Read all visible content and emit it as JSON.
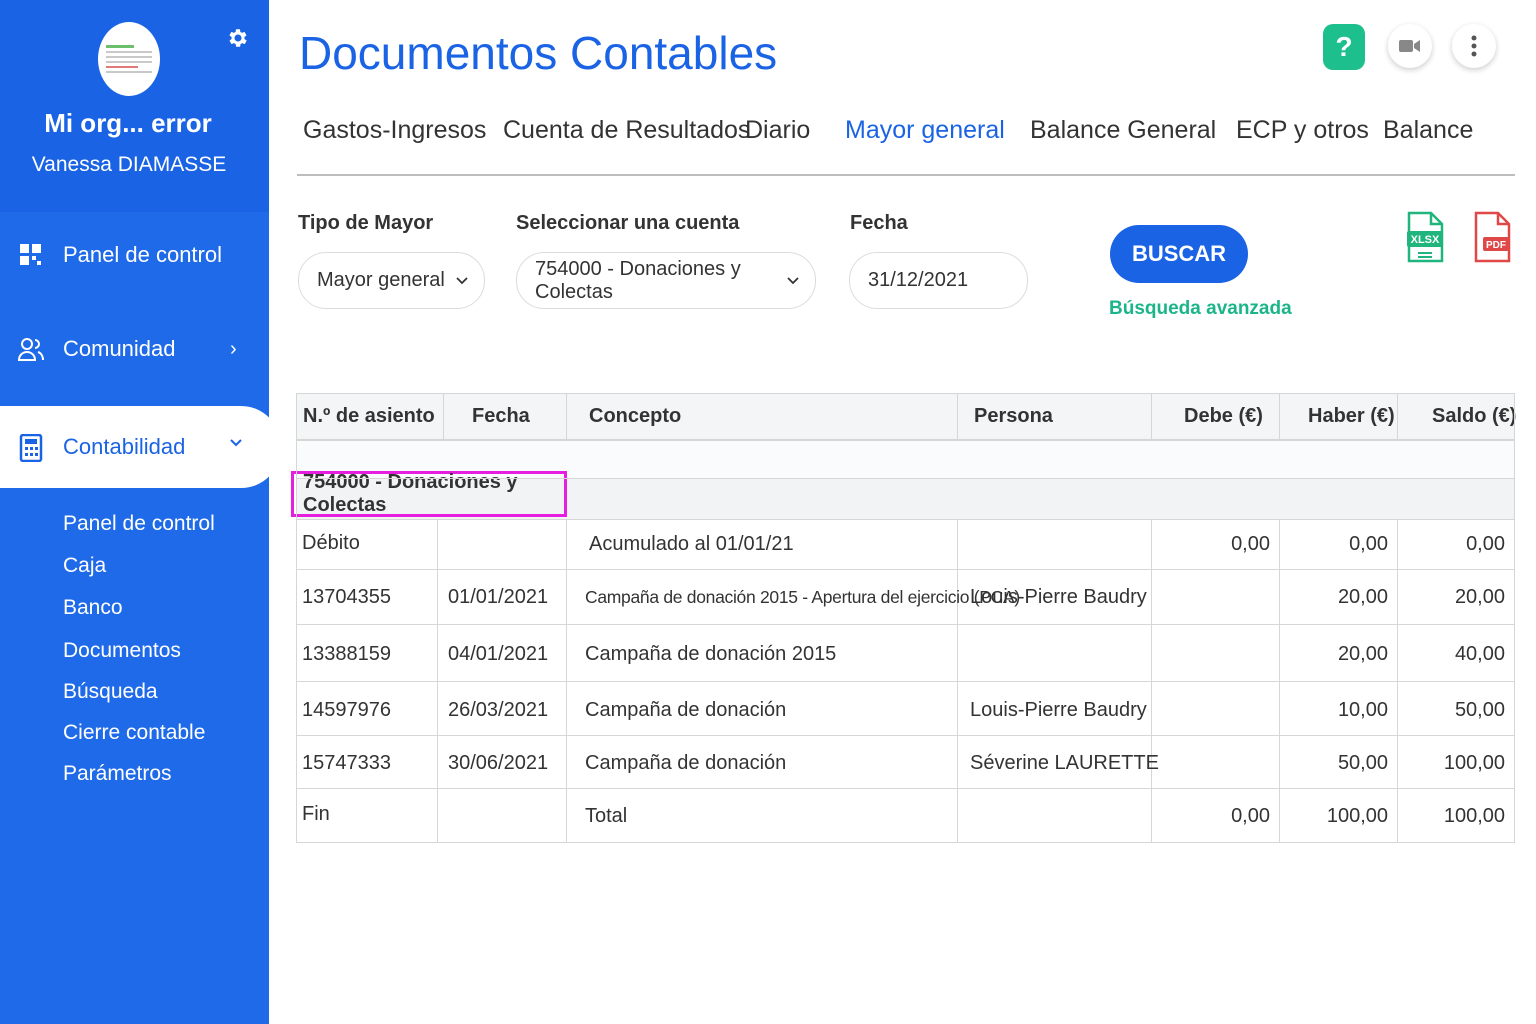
{
  "sidebar": {
    "org_name": "Mi org... error",
    "user_name": "Vanessa DIAMASSE",
    "nav": [
      {
        "label": "Panel de control",
        "icon": "dashboard-icon"
      },
      {
        "label": "Comunidad",
        "icon": "people-icon"
      },
      {
        "label": "Contabilidad",
        "icon": "calculator-icon"
      }
    ],
    "submenu": [
      "Panel de control",
      "Caja",
      "Banco",
      "Documentos",
      "Búsqueda",
      "Cierre contable",
      "Parámetros"
    ]
  },
  "header": {
    "title": "Documentos Contables",
    "help_label": "?"
  },
  "tabs": [
    "Gastos-Ingresos",
    "Cuenta de Resultados",
    "Diario",
    "Mayor general",
    "Balance General",
    "ECP y otros",
    "Balance"
  ],
  "active_tab": "Mayor general",
  "filters": {
    "tipo_label": "Tipo de Mayor",
    "tipo_value": "Mayor general",
    "cuenta_label": "Seleccionar una cuenta",
    "cuenta_value": "754000 - Donaciones y Colectas",
    "fecha_label": "Fecha",
    "fecha_value": "31/12/2021",
    "buscar_label": "BUSCAR",
    "advanced_label": "Búsqueda avanzada"
  },
  "exports": {
    "xlsx": "XLSX",
    "pdf": "PDF"
  },
  "table": {
    "headers": [
      "N.º de asiento",
      "Fecha",
      "Concepto",
      "Persona",
      "Debe (€)",
      "Haber (€)",
      "Saldo (€)"
    ],
    "account": "754000 - Donaciones y Colectas",
    "rows": [
      {
        "asiento": "Débito",
        "fecha": "",
        "concepto": "Acumulado al 01/01/21",
        "persona": "",
        "debe": "0,00",
        "haber": "0,00",
        "saldo": "0,00"
      },
      {
        "asiento": "13704355",
        "fecha": "01/01/2021",
        "concepto": "Campaña de donación 2015 - Apertura del ejercicio (PCA)",
        "persona": "Louis-Pierre Baudry",
        "debe": "",
        "haber": "20,00",
        "saldo": "20,00"
      },
      {
        "asiento": "13388159",
        "fecha": "04/01/2021",
        "concepto": "Campaña de donación 2015",
        "persona": "",
        "debe": "",
        "haber": "20,00",
        "saldo": "40,00"
      },
      {
        "asiento": "14597976",
        "fecha": "26/03/2021",
        "concepto": "Campaña de donación",
        "persona": "Louis-Pierre Baudry",
        "debe": "",
        "haber": "10,00",
        "saldo": "50,00"
      },
      {
        "asiento": "15747333",
        "fecha": "30/06/2021",
        "concepto": "Campaña de donación",
        "persona": "Séverine LAURETTE",
        "debe": "",
        "haber": "50,00",
        "saldo": "100,00"
      },
      {
        "asiento": "Fin",
        "fecha": "",
        "concepto": "Total",
        "persona": "",
        "debe": "0,00",
        "haber": "100,00",
        "saldo": "100,00"
      }
    ]
  },
  "colors": {
    "primary": "#1a63e4",
    "accent_green": "#1cb58a",
    "highlight": "#e61ee0",
    "xlsx": "#1fb57d",
    "pdf": "#e04848"
  }
}
